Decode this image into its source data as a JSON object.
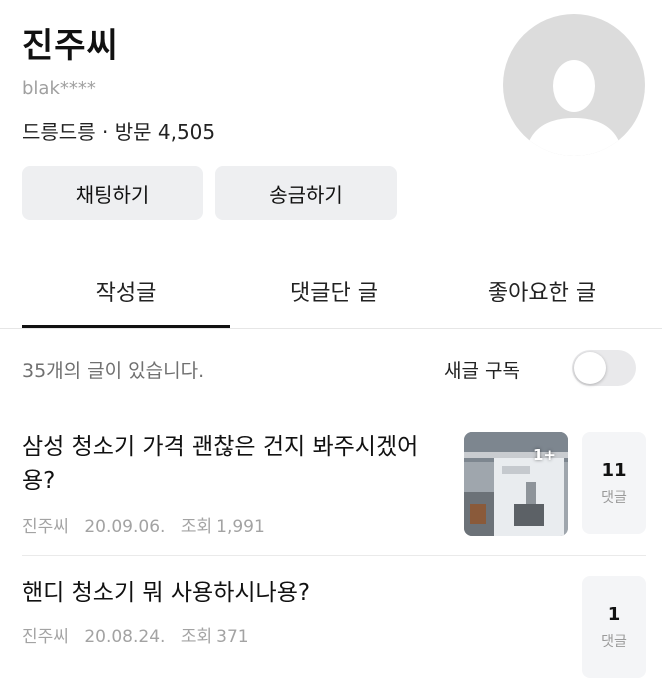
{
  "profile": {
    "name": "진주씨",
    "user_id": "blak****",
    "level": "드릉드릉",
    "visit_label": "방문",
    "visit_count": "4,505",
    "avatar_icon": "person-silhouette-icon"
  },
  "actions": {
    "chat_label": "채팅하기",
    "send_money_label": "송금하기"
  },
  "tabs": [
    {
      "label": "작성글",
      "active": true
    },
    {
      "label": "댓글단 글",
      "active": false
    },
    {
      "label": "좋아요한 글",
      "active": false
    }
  ],
  "list_header": {
    "count_text": "35개의 글이 있습니다.",
    "subscribe_label": "새글 구독",
    "subscribe_on": false
  },
  "posts": [
    {
      "title": "삼성 청소기 가격 괜찮은 건지 봐주시겠어용?",
      "author": "진주씨",
      "date": "20.09.06.",
      "views_label": "조회",
      "views": "1,991",
      "thumbnail_badge": "1+",
      "comment_count": "11",
      "comment_label": "댓글"
    },
    {
      "title": "핸디 청소기 뭐 사용하시나용?",
      "author": "진주씨",
      "date": "20.08.24.",
      "views_label": "조회",
      "views": "371",
      "comment_count": "1",
      "comment_label": "댓글"
    }
  ],
  "colors": {
    "button_bg": "#eeeff1",
    "avatar_bg": "#dcdcdc",
    "meta_text": "#a3a3a3",
    "toggle_off": "#e9e9eb"
  }
}
